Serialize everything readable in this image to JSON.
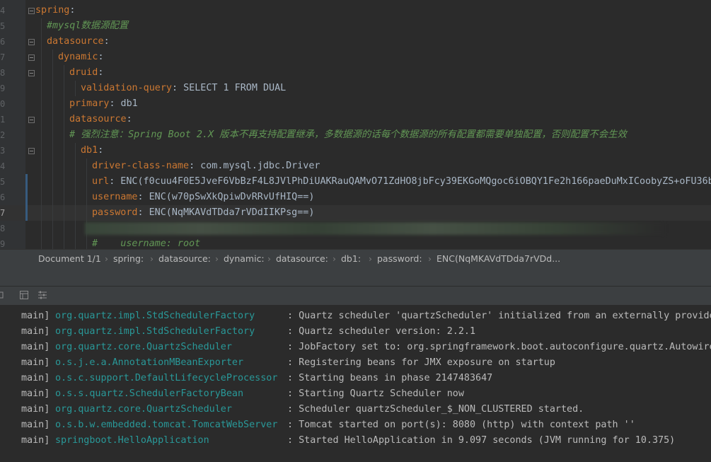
{
  "editor": {
    "lines": [
      {
        "n": "4",
        "parts": [
          {
            "t": "spring",
            "c": "k"
          },
          {
            "t": ":",
            "c": "v"
          }
        ]
      },
      {
        "n": "5",
        "parts": [
          {
            "t": "#mysql数据源配置",
            "c": "c"
          }
        ]
      },
      {
        "n": "6",
        "parts": [
          {
            "t": "datasource",
            "c": "k"
          },
          {
            "t": ":",
            "c": "v"
          }
        ]
      },
      {
        "n": "7",
        "parts": [
          {
            "t": "dynamic",
            "c": "k"
          },
          {
            "t": ":",
            "c": "v"
          }
        ]
      },
      {
        "n": "8",
        "parts": [
          {
            "t": "druid",
            "c": "k"
          },
          {
            "t": ":",
            "c": "v"
          }
        ]
      },
      {
        "n": "9",
        "parts": [
          {
            "t": "validation-query",
            "c": "k"
          },
          {
            "t": ": SELECT 1 FROM DUAL",
            "c": "v"
          }
        ]
      },
      {
        "n": "0",
        "parts": [
          {
            "t": "primary",
            "c": "k"
          },
          {
            "t": ": db1",
            "c": "v"
          }
        ]
      },
      {
        "n": "1",
        "parts": [
          {
            "t": "datasource",
            "c": "k"
          },
          {
            "t": ":",
            "c": "v"
          }
        ]
      },
      {
        "n": "2",
        "parts": [
          {
            "t": "# 强烈注意：Spring Boot 2.X 版本不再支持配置继承，多数据源的话每个数据源的所有配置都需要单独配置，否则配置不会生效",
            "c": "c"
          }
        ]
      },
      {
        "n": "3",
        "parts": [
          {
            "t": "db1",
            "c": "k"
          },
          {
            "t": ":",
            "c": "v"
          }
        ]
      },
      {
        "n": "4",
        "parts": [
          {
            "t": "driver-class-name",
            "c": "k"
          },
          {
            "t": ": com.mysql.jdbc.Driver",
            "c": "v"
          }
        ]
      },
      {
        "n": "5",
        "parts": [
          {
            "t": "url",
            "c": "k"
          },
          {
            "t": ": ENC(f0cuu4F0E5JveF6VbBzF4L8JVlPhDiUAKRauQAMvO71ZdHO8jbFcy39EKGoMQgoc6iOBQY1Fe2h166paeDuMxICoobyZS+oFU36bT",
            "c": "v"
          }
        ]
      },
      {
        "n": "6",
        "parts": [
          {
            "t": "username",
            "c": "k"
          },
          {
            "t": ": ENC(w70pSwXkQpiwDvRRvUfHIQ==)",
            "c": "v"
          }
        ]
      },
      {
        "n": "7",
        "parts": [
          {
            "t": "password",
            "c": "k"
          },
          {
            "t": ": ENC(NqMKAVdTDda7rVDdIIKPsg==)",
            "c": "v"
          }
        ]
      },
      {
        "n": "8",
        "parts": []
      },
      {
        "n": "9",
        "parts": [
          {
            "t": "#    username: root",
            "c": "c"
          }
        ]
      }
    ]
  },
  "breadcrumb": {
    "doc": "Document 1/1",
    "items": [
      "spring:",
      "datasource:",
      "dynamic:",
      "datasource:",
      "db1:",
      "password:",
      "ENC(NqMKAVdTDda7rVDd..."
    ]
  },
  "toolbar": {
    "icons": [
      "panel-icon",
      "grid-icon",
      "settings-list-icon"
    ]
  },
  "console": {
    "lines": [
      {
        "thread": "main]",
        "logger": "org.quartz.impl.StdSchedulerFactory",
        "msg": ": Quartz scheduler 'quartzScheduler' initialized from an externally provide"
      },
      {
        "thread": "main]",
        "logger": "org.quartz.impl.StdSchedulerFactory",
        "msg": ": Quartz scheduler version: 2.2.1"
      },
      {
        "thread": "main]",
        "logger": "org.quartz.core.QuartzScheduler",
        "msg": ": JobFactory set to: org.springframework.boot.autoconfigure.quartz.Autowire"
      },
      {
        "thread": "main]",
        "logger": "o.s.j.e.a.AnnotationMBeanExporter",
        "msg": ": Registering beans for JMX exposure on startup"
      },
      {
        "thread": "main]",
        "logger": "o.s.c.support.DefaultLifecycleProcessor",
        "msg": ": Starting beans in phase 2147483647"
      },
      {
        "thread": "main]",
        "logger": "o.s.s.quartz.SchedulerFactoryBean",
        "msg": ": Starting Quartz Scheduler now"
      },
      {
        "thread": "main]",
        "logger": "org.quartz.core.QuartzScheduler",
        "msg": ": Scheduler quartzScheduler_$_NON_CLUSTERED started."
      },
      {
        "thread": "main]",
        "logger": "o.s.b.w.embedded.tomcat.TomcatWebServer",
        "msg": ": Tomcat started on port(s): 8080 (http) with context path ''"
      },
      {
        "thread": "main]",
        "logger": "springboot.HelloApplication",
        "msg": ": Started HelloApplication in 9.097 seconds (JVM running for 10.375)"
      }
    ]
  },
  "colors": {
    "keyword": "#cc7832",
    "value": "#a9b7c6",
    "comment": "#629755",
    "logger": "#299999",
    "background": "#2b2b2b"
  }
}
